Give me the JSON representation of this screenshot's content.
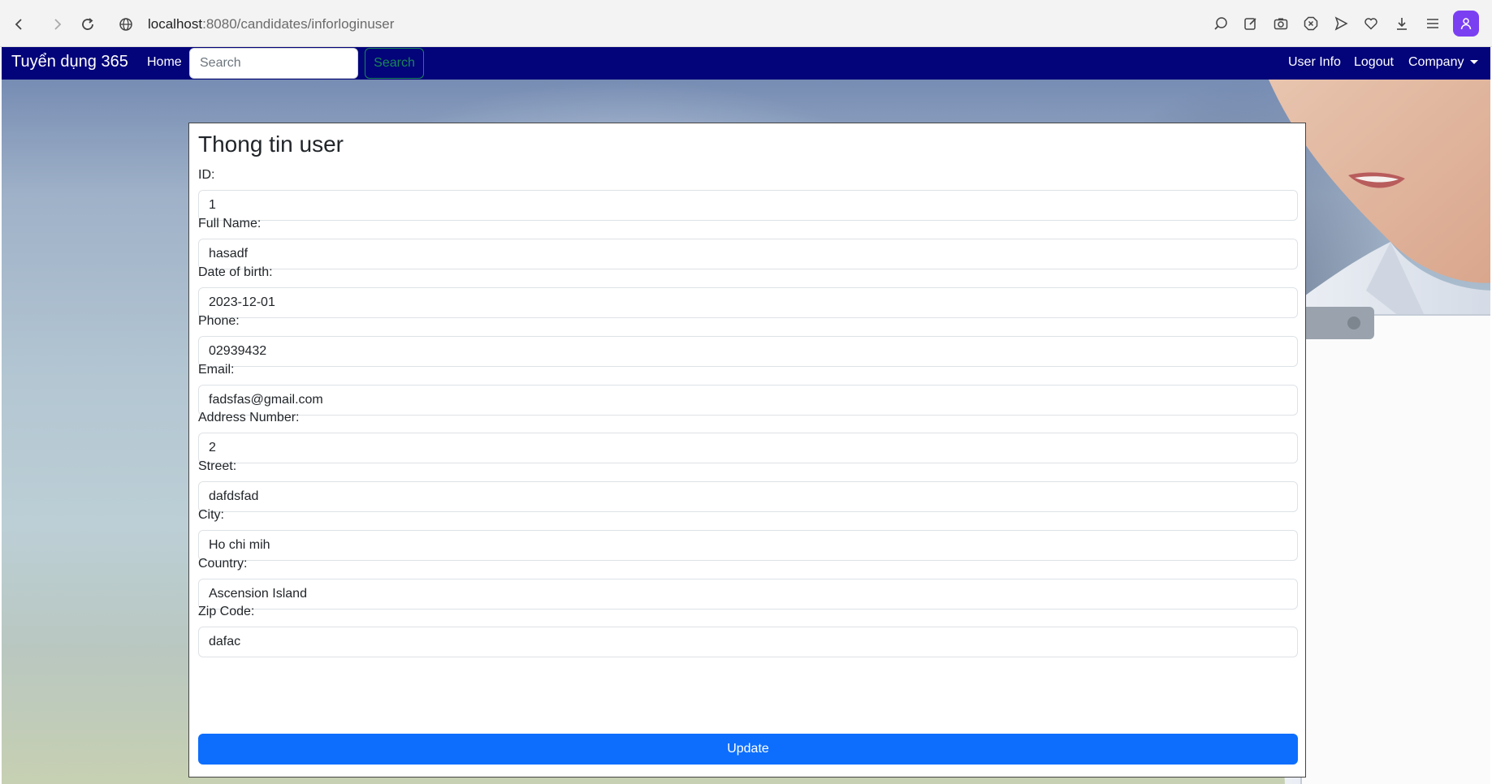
{
  "browser": {
    "url_host": "localhost",
    "url_path": ":8080/candidates/inforloginuser"
  },
  "navbar": {
    "brand": "Tuyển dụng 365",
    "home": "Home",
    "search_placeholder": "Search",
    "search_button": "Search",
    "user_info": "User Info",
    "logout": "Logout",
    "company": "Company"
  },
  "form": {
    "title": "Thong tin user",
    "fields": [
      {
        "label": "ID:",
        "value": "1"
      },
      {
        "label": "Full Name:",
        "value": "hasadf"
      },
      {
        "label": "Date of birth:",
        "value": "2023-12-01"
      },
      {
        "label": "Phone:",
        "value": "02939432"
      },
      {
        "label": "Email:",
        "value": "fadsfas@gmail.com"
      },
      {
        "label": "Address Number:",
        "value": "2"
      },
      {
        "label": "Street:",
        "value": "dafdsfad"
      },
      {
        "label": "City:",
        "value": "Ho chi mih"
      },
      {
        "label": "Country:",
        "value": "Ascension Island"
      },
      {
        "label": "Zip Code:",
        "value": "dafac"
      }
    ],
    "update_button": "Update"
  },
  "colors": {
    "navbar_bg": "#03037a",
    "primary_button": "#0d6efd",
    "success_outline": "#198754"
  }
}
